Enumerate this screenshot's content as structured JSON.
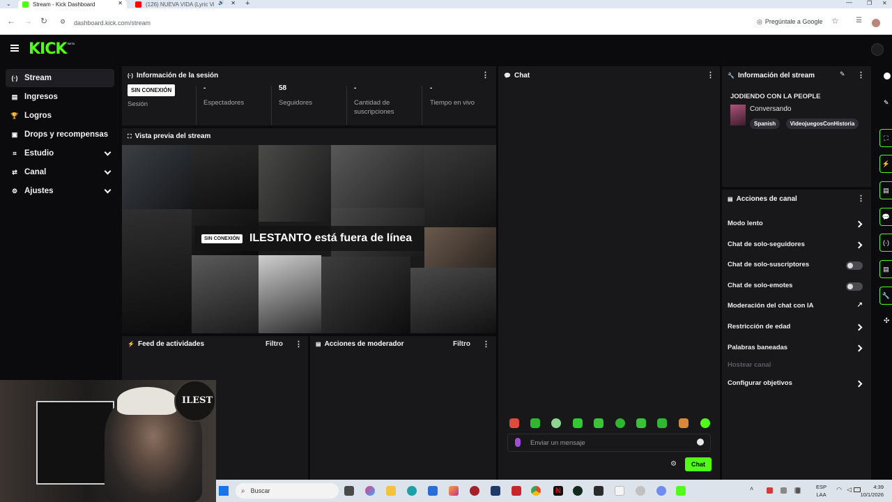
{
  "browser": {
    "tabs": [
      {
        "title": "Stream - Kick Dashboard",
        "active": true
      },
      {
        "title": "(126) NUEVA VIDA (Lyric Vi",
        "active": false
      }
    ],
    "url": "dashboard.kick.com/stream",
    "google_button": "Pregúntale a Google"
  },
  "header": {
    "logo": "KICK",
    "logo_badge": "BETA"
  },
  "sidebar": {
    "items": [
      {
        "label": "Stream",
        "icon": "broadcast-icon",
        "active": true,
        "expandable": false
      },
      {
        "label": "Ingresos",
        "icon": "income-icon",
        "expandable": false
      },
      {
        "label": "Logros",
        "icon": "trophy-icon",
        "expandable": false
      },
      {
        "label": "Drops y recompensas",
        "icon": "gift-icon",
        "expandable": false
      },
      {
        "label": "Estudio",
        "icon": "studio-icon",
        "expandable": true
      },
      {
        "label": "Canal",
        "icon": "channel-icon",
        "expandable": true
      },
      {
        "label": "Ajustes",
        "icon": "gear-icon",
        "expandable": true
      }
    ]
  },
  "session": {
    "title": "Información de la sesión",
    "stats": [
      {
        "value": "SIN CONEXIÓN",
        "label": "Sesión"
      },
      {
        "value": "-",
        "label": "Espectadores"
      },
      {
        "value": "58",
        "label": "Seguidores"
      },
      {
        "value": "-",
        "label": "Cantidad de suscripciones"
      },
      {
        "value": "-",
        "label": "Tiempo en vivo"
      }
    ]
  },
  "preview": {
    "title": "Vista previa del stream",
    "badge": "SIN CONEXIÓN",
    "message": "ILESTANTO está fuera de línea"
  },
  "activity_feed": {
    "title": "Feed de actividades",
    "filter": "Filtro"
  },
  "mod_actions": {
    "title": "Acciones de moderador",
    "filter": "Filtro"
  },
  "chat": {
    "title": "Chat",
    "input_placeholder": "Enviar un mensaje",
    "send_label": "Chat",
    "accent": "#53fc18"
  },
  "stream_info": {
    "title": "Información del stream",
    "stream_title": "JODIENDO CON LA PEOPLE",
    "category": "Conversando",
    "tags": [
      "Spanish",
      "VideojuegosConHistoria"
    ]
  },
  "channel_actions": {
    "title": "Acciones de canal",
    "items": [
      {
        "label": "Modo lento",
        "control": "chevron"
      },
      {
        "label": "Chat de solo-seguidores",
        "control": "chevron"
      },
      {
        "label": "Chat de solo-suscriptores",
        "control": "toggle"
      },
      {
        "label": "Chat de solo-emotes",
        "control": "toggle"
      },
      {
        "label": "Moderación del chat con IA",
        "control": "external"
      },
      {
        "label": "Restricción de edad",
        "control": "chevron"
      },
      {
        "label": "Palabras baneadas",
        "control": "chevron"
      },
      {
        "label": "Hostear canal",
        "control": "none",
        "disabled": true
      },
      {
        "label": "Configurar objetivos",
        "control": "chevron"
      }
    ]
  },
  "webcam": {
    "logo_text": "ILEST"
  },
  "taskbar": {
    "search_placeholder": "Buscar",
    "lang_top": "ESP",
    "lang_bottom": "LAA",
    "time": "4:39",
    "date": "10/1/2026"
  }
}
